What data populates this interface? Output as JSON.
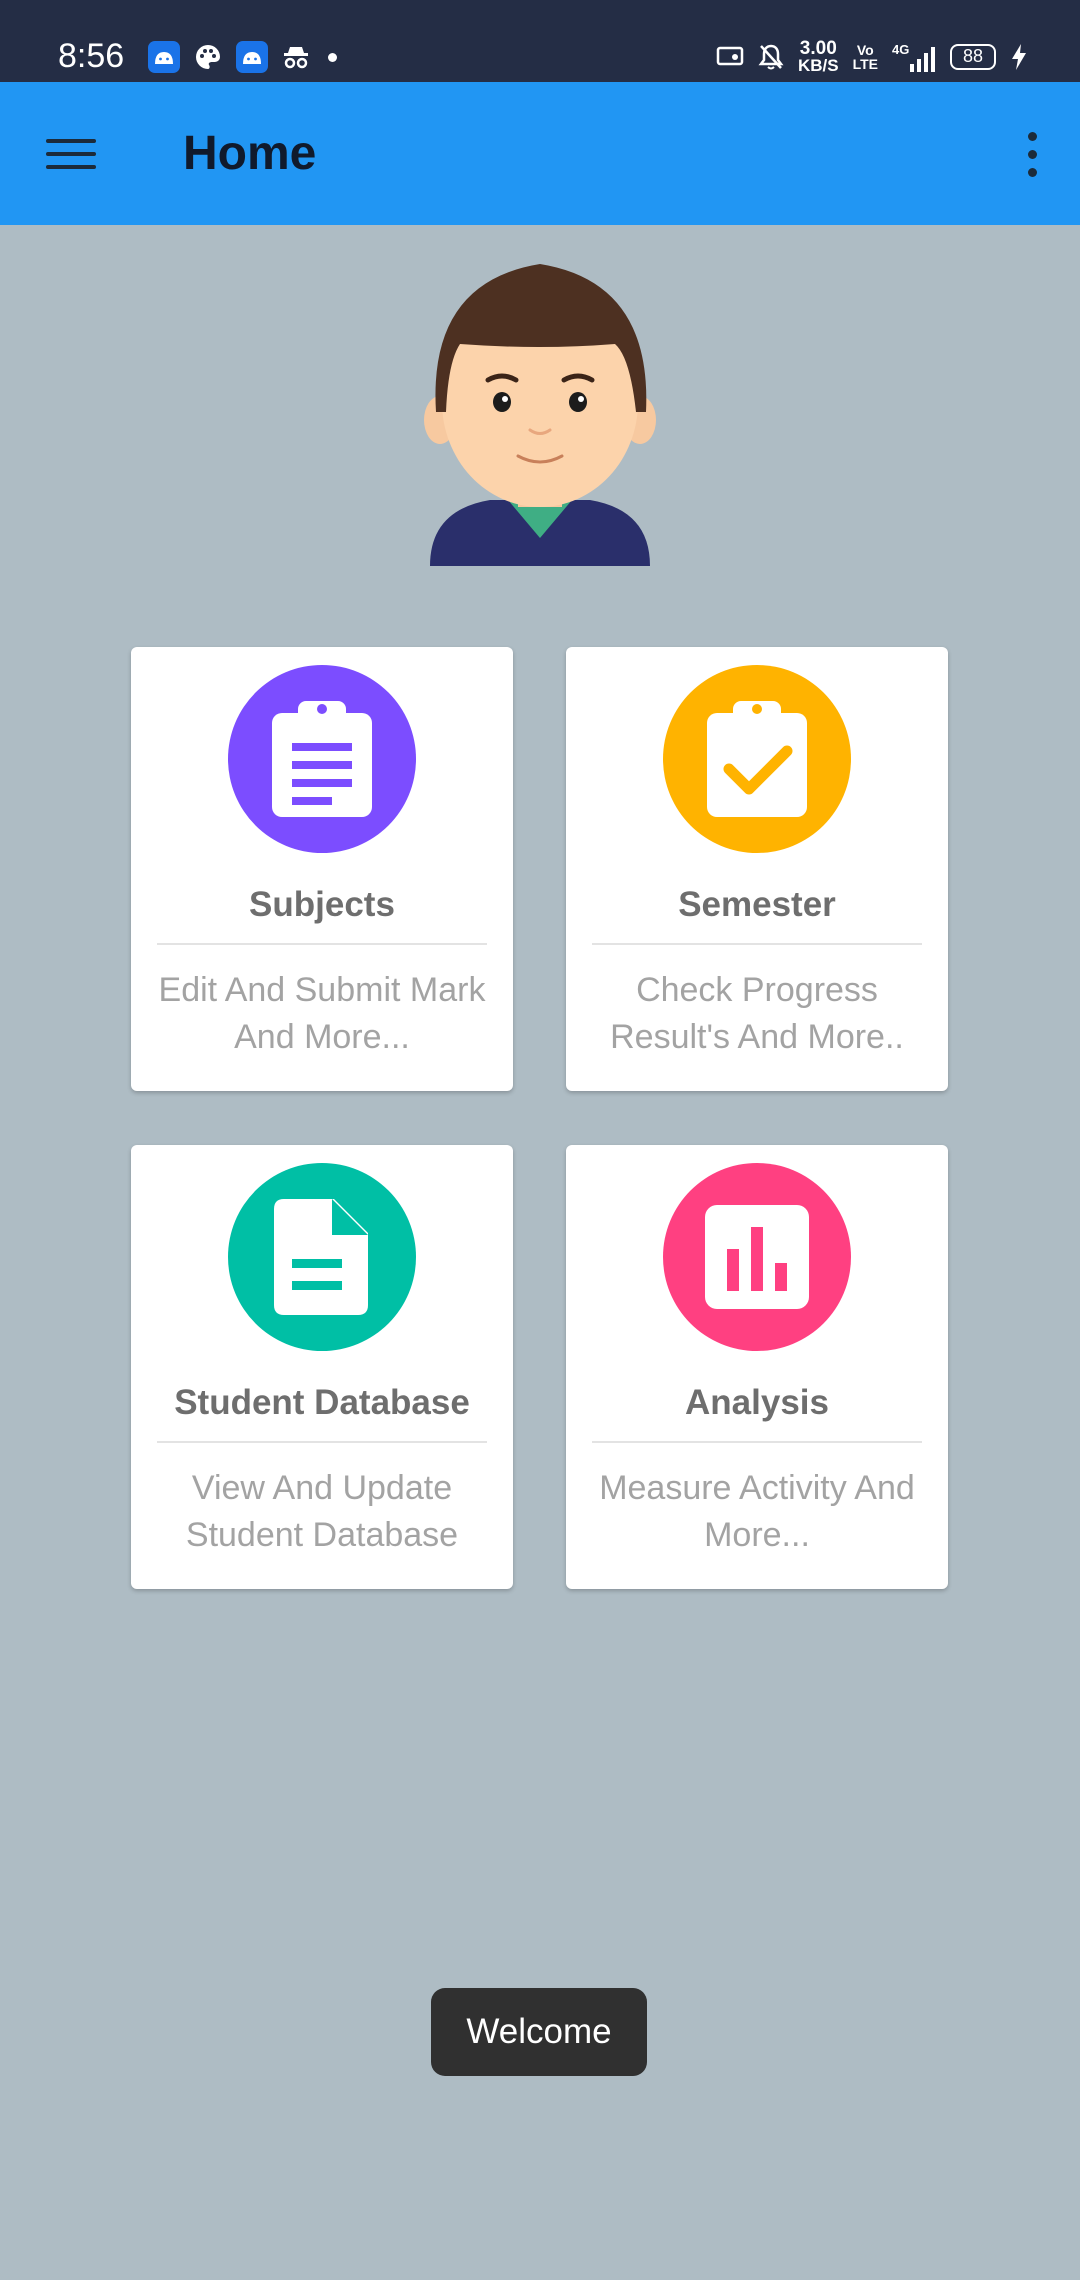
{
  "status_bar": {
    "time": "8:56",
    "net_speed_value": "3.00",
    "net_speed_unit": "KB/S",
    "volte_top": "Vo",
    "volte_bottom": "LTE",
    "network": "4G",
    "battery": "88"
  },
  "app_bar": {
    "title": "Home"
  },
  "cards": [
    {
      "title": "Subjects",
      "description": "Edit And Submit Mark And More...",
      "color": "#7c4dff",
      "icon": "clipboard-list-icon"
    },
    {
      "title": "Semester",
      "description": "Check Progress Result's And More..",
      "color": "#ffb300",
      "icon": "clipboard-check-icon"
    },
    {
      "title": "Student Database",
      "description": "View And Update Student Database",
      "color": "#00bfa5",
      "icon": "document-icon"
    },
    {
      "title": "Analysis",
      "description": "Measure Activity And More...",
      "color": "#ff4081",
      "icon": "bar-chart-icon"
    }
  ],
  "toast": {
    "text": "Welcome"
  },
  "colors": {
    "status_bar": "#242d45",
    "app_bar": "#2196f3",
    "background": "#aebcc4"
  }
}
